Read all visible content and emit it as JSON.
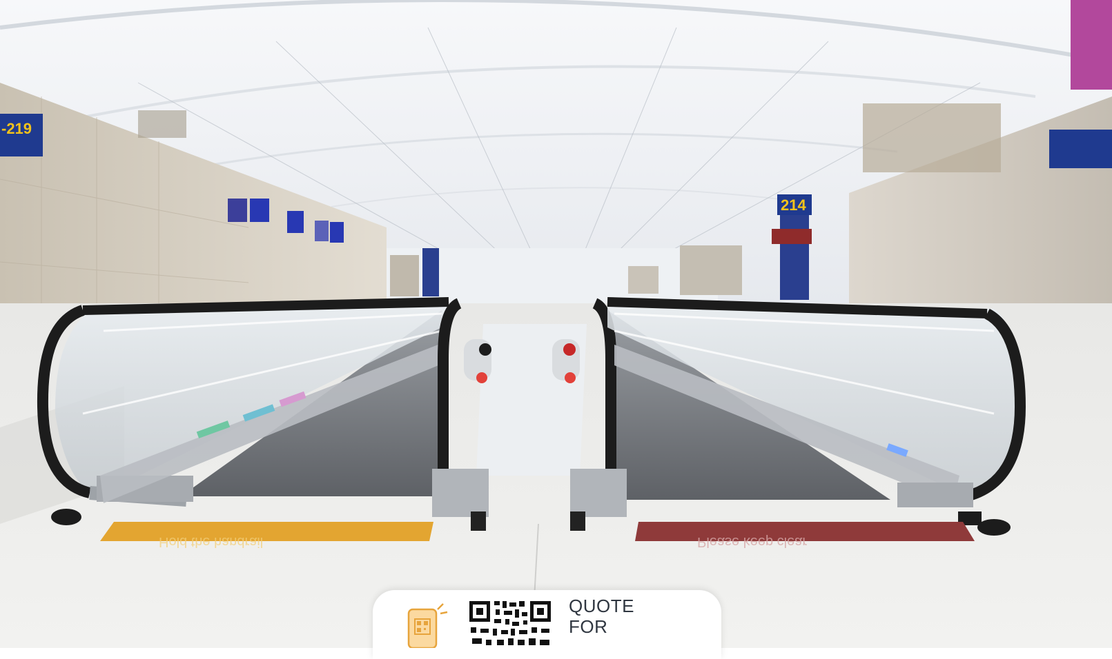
{
  "hero": {
    "gate_sign_left": "-219",
    "gate_sign_right": "214",
    "floor_label_left": "Hold the handrail",
    "floor_label_right": "Please keep clear"
  },
  "quote_card": {
    "line1": "QUOTE",
    "line2": "FOR"
  },
  "colors": {
    "brand_tab": "#b2489c",
    "sign_blue": "#1f3a8f",
    "sign_yellow": "#f2c21b",
    "floor_yellow": "#e3a531",
    "floor_red": "#8f3a3a"
  },
  "icons": [
    "mobile-qr-scan-icon",
    "qr-code-icon"
  ]
}
